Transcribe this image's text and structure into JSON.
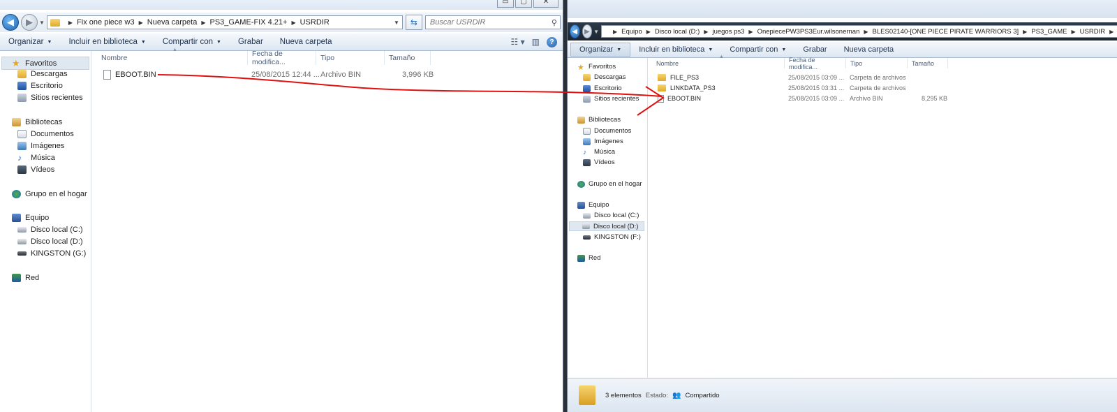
{
  "left": {
    "caption_buttons": {
      "minimize": "▭",
      "maximize": "▢",
      "close": "✕"
    },
    "breadcrumbs": [
      "Fix one piece w3",
      "Nueva carpeta",
      "PS3_GAME-FIX 4.21+",
      "USRDIR"
    ],
    "search_placeholder": "Buscar USRDIR",
    "toolbar": {
      "organize": "Organizar",
      "include": "Incluir en biblioteca",
      "share": "Compartir con",
      "burn": "Grabar",
      "new_folder": "Nueva carpeta"
    },
    "nav": {
      "favorites": "Favoritos",
      "downloads": "Descargas",
      "desktop": "Escritorio",
      "recent": "Sitios recientes",
      "libraries": "Bibliotecas",
      "documents": "Documentos",
      "images": "Imágenes",
      "music": "Música",
      "videos": "Vídeos",
      "homegroup": "Grupo en el hogar",
      "computer": "Equipo",
      "disk_c": "Disco local (C:)",
      "disk_d": "Disco local (D:)",
      "usb": "KINGSTON (G:)",
      "network": "Red"
    },
    "columns": {
      "name": "Nombre",
      "date": "Fecha de modifica...",
      "type": "Tipo",
      "size": "Tamaño"
    },
    "files": [
      {
        "name": "EBOOT.BIN",
        "date": "25/08/2015 12:44 ...",
        "type": "Archivo BIN",
        "size": "3,996 KB"
      }
    ]
  },
  "right": {
    "breadcrumbs": [
      "Equipo",
      "Disco local (D:)",
      "juegos ps3",
      "OnepiecePW3PS3Eur.wilsonernan",
      "BLES02140-[ONE PIECE PIRATE WARRIORS 3]",
      "PS3_GAME",
      "USRDIR"
    ],
    "toolbar": {
      "organize": "Organizar",
      "include": "Incluir en biblioteca",
      "share": "Compartir con",
      "burn": "Grabar",
      "new_folder": "Nueva carpeta"
    },
    "nav": {
      "favorites": "Favoritos",
      "downloads": "Descargas",
      "desktop": "Escritorio",
      "recent": "Sitios recientes",
      "libraries": "Bibliotecas",
      "documents": "Documentos",
      "images": "Imágenes",
      "music": "Música",
      "videos": "Vídeos",
      "homegroup": "Grupo en el hogar",
      "computer": "Equipo",
      "disk_c": "Disco local (C:)",
      "disk_d": "Disco local (D:)",
      "usb": "KINGSTON (F:)",
      "network": "Red"
    },
    "columns": {
      "name": "Nombre",
      "date": "Fecha de modifica...",
      "type": "Tipo",
      "size": "Tamaño"
    },
    "files": [
      {
        "name": "FILE_PS3",
        "date": "25/08/2015 03:09 ...",
        "type": "Carpeta de archivos",
        "size": ""
      },
      {
        "name": "LINKDATA_PS3",
        "date": "25/08/2015 03:31 ...",
        "type": "Carpeta de archivos",
        "size": ""
      },
      {
        "name": "EBOOT.BIN",
        "date": "25/08/2015 03:09 ...",
        "type": "Archivo BIN",
        "size": "8,295 KB"
      }
    ],
    "status": {
      "count": "3 elementos",
      "state_label": "Estado:",
      "state_value": "Compartido"
    }
  },
  "annotation_color": "#e01010"
}
